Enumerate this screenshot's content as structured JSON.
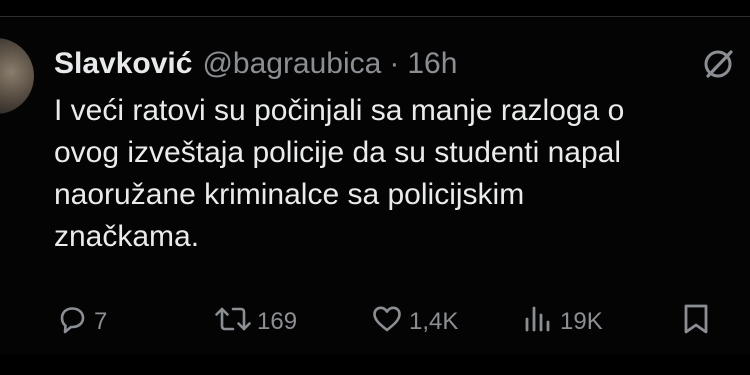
{
  "author": {
    "display_name": "Slavković",
    "handle": "@bagraubica",
    "separator": "·",
    "timestamp": "16h"
  },
  "tweet": {
    "lines": [
      "I veći ratovi su počinjali sa manje razloga o",
      "ovog izveštaja policije da su studenti napal",
      "naoružane kriminalce sa policijskim",
      "značkama."
    ]
  },
  "actions": {
    "replies": "7",
    "reposts": "169",
    "likes": "1,4K",
    "views": "19K"
  },
  "icons": {
    "reply": "reply-icon",
    "repost": "repost-icon",
    "like": "heart-icon",
    "views": "views-icon",
    "bookmark": "bookmark-icon",
    "grok": "grok-icon"
  },
  "colors": {
    "background": "#040404",
    "text": "#e7e9ea",
    "muted": "#8b8f94"
  }
}
